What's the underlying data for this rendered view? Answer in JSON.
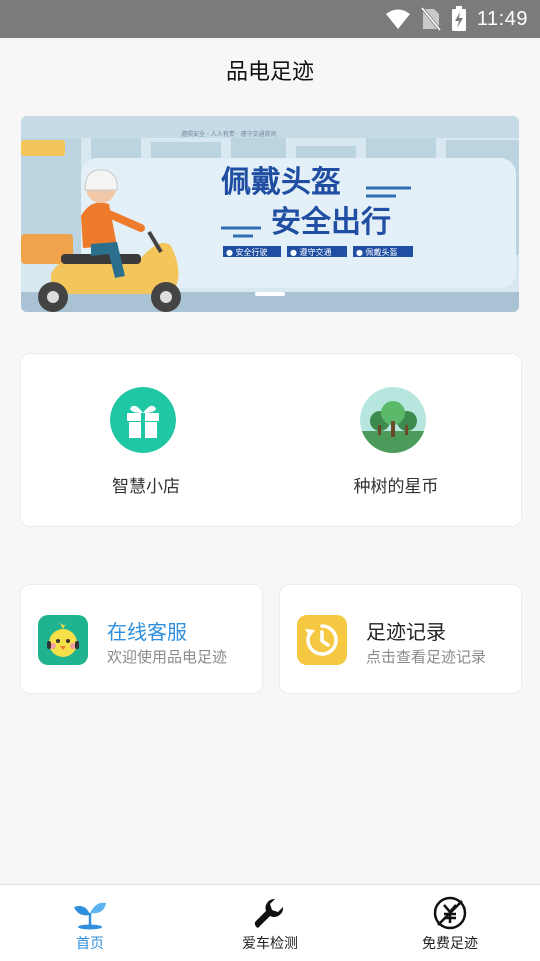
{
  "status_bar": {
    "time": "11:49"
  },
  "header": {
    "title": "品电足迹"
  },
  "banner": {
    "headline_1": "佩戴头盔",
    "headline_2": "安全出行",
    "tags": [
      "● 安全行驶",
      "● 遵守交通",
      "● 佩戴头盔"
    ],
    "top_caption": "遵照安全 · 人人有责 · 遵守交通规则",
    "page_count": 1,
    "active_page": 1
  },
  "quick_actions": [
    {
      "label": "智慧小店",
      "icon": "gift-icon"
    },
    {
      "label": "种树的星币",
      "icon": "tree-icon"
    }
  ],
  "services": [
    {
      "title": "在线客服",
      "subtitle": "欢迎使用品电足迹",
      "icon": "chick-mascot-icon",
      "color": "#2f8fdc",
      "icon_bg": "#1fb38f"
    },
    {
      "title": "足迹记录",
      "subtitle": "点击查看足迹记录",
      "icon": "history-clock-icon",
      "color": "#222222",
      "icon_bg": "#f5c842"
    }
  ],
  "tab_bar": {
    "items": [
      {
        "label": "首页",
        "icon": "sprout-icon",
        "active": true
      },
      {
        "label": "爱车检测",
        "icon": "wrench-icon",
        "active": false
      },
      {
        "label": "免费足迹",
        "icon": "no-charge-icon",
        "active": false
      }
    ]
  },
  "colors": {
    "accent": "#2f8fdc",
    "banner_text": "#1f4ea3"
  }
}
